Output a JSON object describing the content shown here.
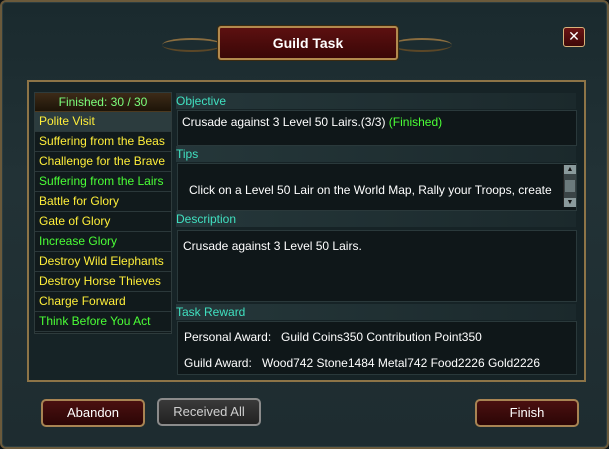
{
  "window": {
    "title": "Guild Task",
    "close_label": "✕"
  },
  "task_list": {
    "header": "Finished: 30 / 30",
    "items": [
      {
        "label": "Polite Visit",
        "color": "#ffef3a"
      },
      {
        "label": "Suffering from the Beas",
        "color": "#ffef3a"
      },
      {
        "label": "Challenge for the Brave",
        "color": "#ffef3a"
      },
      {
        "label": "Suffering from the Lairs",
        "color": "#4bff36"
      },
      {
        "label": "Battle for Glory",
        "color": "#ffef3a"
      },
      {
        "label": "Gate of Glory",
        "color": "#ffef3a"
      },
      {
        "label": "Increase Glory",
        "color": "#4bff36"
      },
      {
        "label": "Destroy Wild Elephants",
        "color": "#ffef3a"
      },
      {
        "label": "Destroy Horse Thieves",
        "color": "#ffef3a"
      },
      {
        "label": "Charge Forward",
        "color": "#ffef3a"
      },
      {
        "label": "Think Before You Act",
        "color": "#4bff36"
      }
    ]
  },
  "objective": {
    "title": "Objective",
    "text": "Crusade against 3 Level 50 Lairs.(3/3)",
    "status": "(Finished)"
  },
  "tips": {
    "title": "Tips",
    "text": "Click on a Level 50 Lair on the World Map, Rally your Troops, create"
  },
  "description": {
    "title": "Description",
    "text": "Crusade against 3 Level 50 Lairs."
  },
  "reward": {
    "title": "Task Reward",
    "personal_label": "Personal Award:",
    "personal_values": "Guild Coins350  Contribution Point350",
    "guild_label": "Guild Award:",
    "guild_values": "Wood742  Stone1484  Metal742  Food2226  Gold2226"
  },
  "buttons": {
    "abandon": "Abandon",
    "received_all": "Received All",
    "finish": "Finish"
  }
}
